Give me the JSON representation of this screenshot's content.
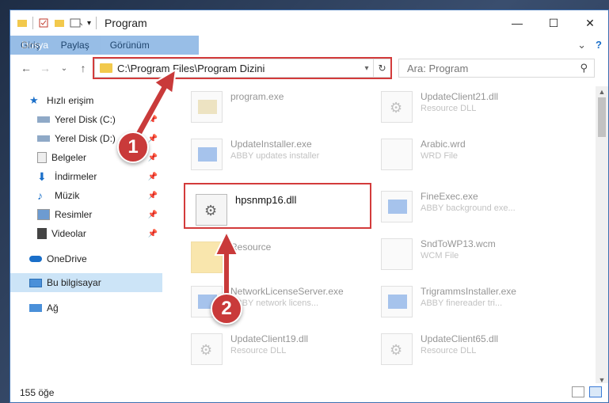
{
  "window": {
    "title": "Program",
    "controls": {
      "minimize": "—",
      "maximize": "☐",
      "close": "✕"
    }
  },
  "ribbon": {
    "tabs": [
      "Dosya",
      "Giriş",
      "Paylaş",
      "Görünüm"
    ],
    "expand": "⌄",
    "help": "?"
  },
  "navigation": {
    "back": "←",
    "forward": "→",
    "recent": "⌄",
    "up": "↑",
    "address": "C:\\Program Files\\Program Dizini",
    "search_placeholder": "Ara: Program"
  },
  "sidebar": {
    "items": [
      {
        "label": "Hızlı erişim",
        "icon": "star-icon"
      },
      {
        "label": "Yerel Disk (C:)",
        "icon": "disk-icon",
        "pinned": true
      },
      {
        "label": "Yerel Disk (D:)",
        "icon": "disk-icon",
        "pinned": true
      },
      {
        "label": "Belgeler",
        "icon": "documents-icon",
        "pinned": true
      },
      {
        "label": "İndirmeler",
        "icon": "download-icon",
        "pinned": true
      },
      {
        "label": "Müzik",
        "icon": "music-icon",
        "pinned": true
      },
      {
        "label": "Resimler",
        "icon": "pictures-icon",
        "pinned": true
      },
      {
        "label": "Videolar",
        "icon": "videos-icon",
        "pinned": true
      },
      {
        "label": "OneDrive",
        "icon": "cloud-icon"
      },
      {
        "label": "Bu bilgisayar",
        "icon": "computer-icon",
        "selected": true
      },
      {
        "label": "Ağ",
        "icon": "network-icon"
      }
    ]
  },
  "files": [
    {
      "name": "program.exe",
      "sub": ""
    },
    {
      "name": "UpdateClient21.dll",
      "sub": "Resource DLL"
    },
    {
      "name": "UpdateInstaller.exe",
      "sub": "ABBY updates installer"
    },
    {
      "name": "Arabic.wrd",
      "sub": "WRD File"
    },
    {
      "name": "hpsnmp16.dll",
      "sub": ""
    },
    {
      "name": "FineExec.exe",
      "sub": "ABBY background exe..."
    },
    {
      "name": "Resource",
      "sub": ""
    },
    {
      "name": "SndToWP13.wcm",
      "sub": "WCM File"
    },
    {
      "name": "NetworkLicenseServer.exe",
      "sub": "ABBY network licens..."
    },
    {
      "name": "TrigrammsInstaller.exe",
      "sub": "ABBY finereader tri..."
    },
    {
      "name": "UpdateClient19.dll",
      "sub": "Resource DLL"
    },
    {
      "name": "UpdateClient65.dll",
      "sub": "Resource DLL"
    }
  ],
  "status": {
    "count": "155 öğe"
  },
  "callouts": [
    "1",
    "2"
  ],
  "colors": {
    "accent": "#1a6fc9",
    "highlight": "#d33b3b",
    "callout": "#c93a3a",
    "selection": "#cce4f7"
  }
}
